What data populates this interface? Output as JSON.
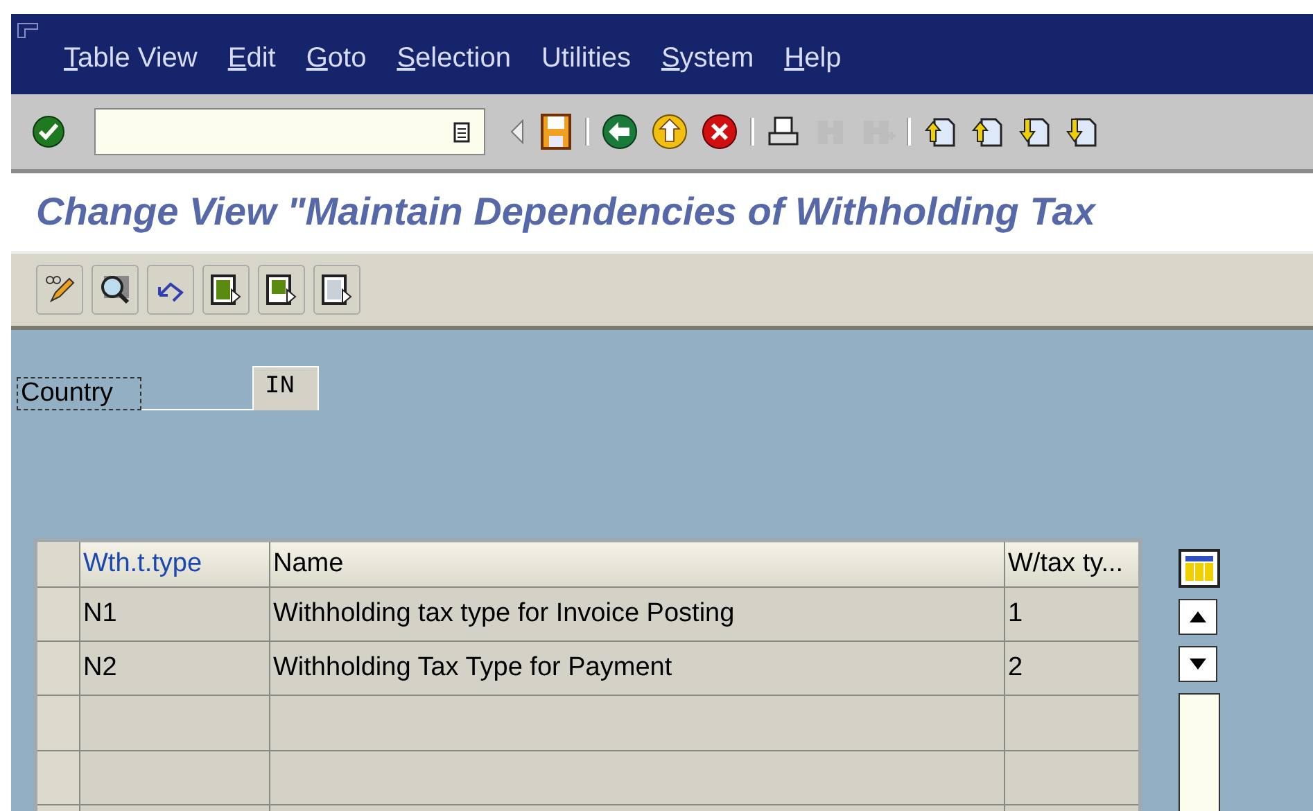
{
  "menu": [
    {
      "label": "Table View",
      "mnemonic": true
    },
    {
      "label": "Edit",
      "mnemonic": true
    },
    {
      "label": "Goto",
      "mnemonic": true
    },
    {
      "label": "Selection",
      "mnemonic": true
    },
    {
      "label": "Utilities",
      "mnemonic": false
    },
    {
      "label": "System",
      "mnemonic": true
    },
    {
      "label": "Help",
      "mnemonic": true
    }
  ],
  "toolbar": [
    {
      "kind": "enter"
    },
    {
      "kind": "command"
    },
    {
      "kind": "back-arrow"
    },
    {
      "kind": "save"
    },
    {
      "kind": "sep"
    },
    {
      "kind": "back"
    },
    {
      "kind": "exit"
    },
    {
      "kind": "cancel"
    },
    {
      "kind": "sep"
    },
    {
      "kind": "print",
      "disabled": false
    },
    {
      "kind": "find",
      "disabled": true
    },
    {
      "kind": "find-next",
      "disabled": true
    },
    {
      "kind": "sep"
    },
    {
      "kind": "first-page"
    },
    {
      "kind": "prev-page"
    },
    {
      "kind": "next-page"
    },
    {
      "kind": "last-page"
    }
  ],
  "title": "Change View \"Maintain Dependencies of Withholding Tax",
  "app_toolbar": [
    {
      "kind": "edit"
    },
    {
      "kind": "display"
    },
    {
      "kind": "undo"
    },
    {
      "kind": "select-all"
    },
    {
      "kind": "select-block"
    },
    {
      "kind": "deselect-all"
    }
  ],
  "country": {
    "label": "Country",
    "value": "IN"
  },
  "table": {
    "columns": [
      {
        "label": "Wth.t.type",
        "key": true
      },
      {
        "label": "Name",
        "key": false
      },
      {
        "label": "W/tax ty...",
        "key": false
      }
    ],
    "rows": [
      {
        "cells": [
          "N1",
          "Withholding tax type for Invoice Posting",
          "1"
        ]
      },
      {
        "cells": [
          "N2",
          "Withholding Tax Type for Payment",
          "2"
        ]
      },
      {
        "cells": []
      },
      {
        "cells": []
      },
      {
        "cells": []
      }
    ]
  }
}
